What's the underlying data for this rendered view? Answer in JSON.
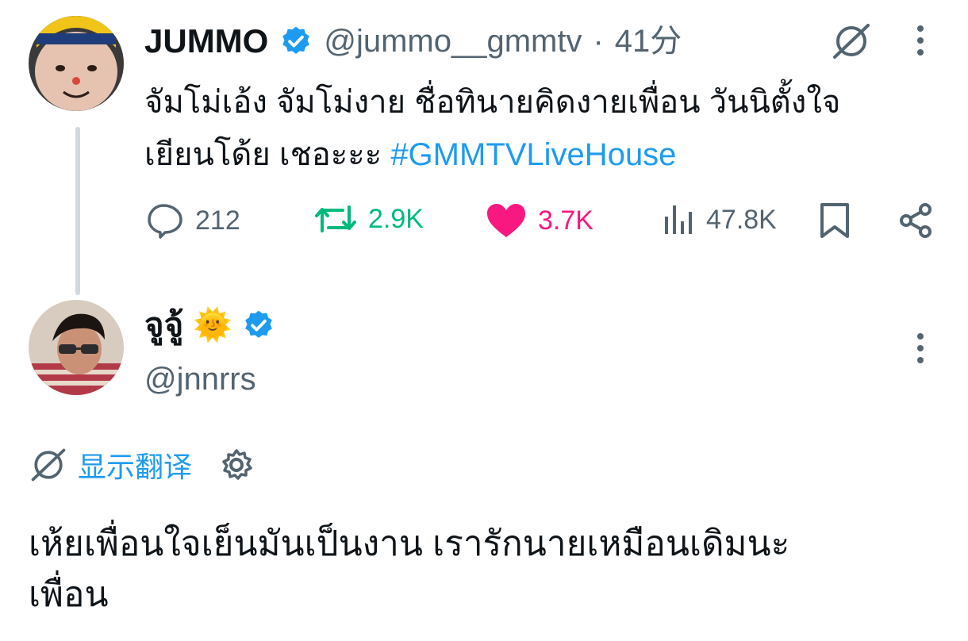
{
  "tweet": {
    "author_name": "JUMMO",
    "author_handle": "@jummo__gmmtv",
    "separator": "·",
    "time": "41分",
    "text_line1": "จัมโม่เอ้ง จัมโม่งาย ชื่อทินายคิดงายเพื่อน วันนิตั้งใจ",
    "text_line2_prefix": "เยียนโด้ย เชอะะะ ",
    "hashtag": "#GMMTVLiveHouse",
    "stats": {
      "replies": "212",
      "retweets": "2.9K",
      "likes": "3.7K",
      "views": "47.8K"
    }
  },
  "reply": {
    "author_name": "จูจู้",
    "author_emoji": "🌞",
    "author_handle": "@jnnrrs",
    "translate_label": "显示翻译",
    "text_line1": "เห้ยเพื่อนใจเย็นมันเป็นงาน เรารักนายเหมือนเดิมนะ",
    "text_line2": "เพื่อน"
  },
  "colors": {
    "accent_blue": "#1d9bf0",
    "retweet_green": "#00ba7c",
    "like_pink": "#f91880",
    "muted": "#536471",
    "thread_line": "#cfd9de"
  },
  "icons": [
    "verified-badge-icon",
    "translate-icon",
    "more-icon",
    "reply-icon",
    "retweet-icon",
    "heart-icon",
    "views-icon",
    "bookmark-icon",
    "share-icon",
    "settings-icon"
  ]
}
